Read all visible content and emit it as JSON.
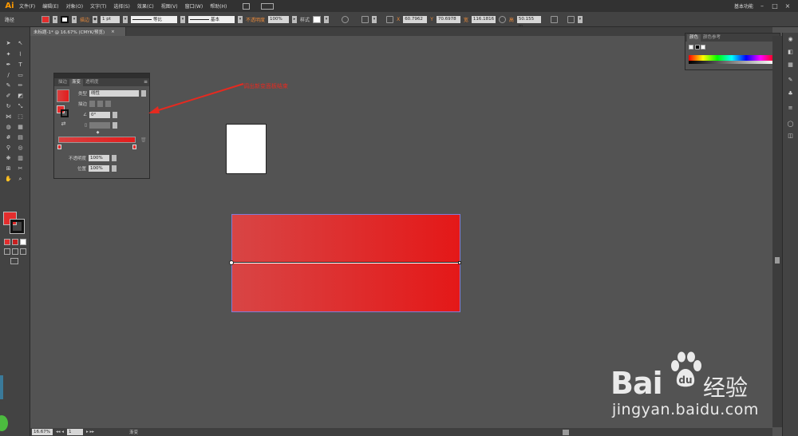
{
  "app": {
    "logo": "Ai",
    "menus": [
      "文件(F)",
      "编辑(E)",
      "对象(O)",
      "文字(T)",
      "选择(S)",
      "效果(C)",
      "视图(V)",
      "窗口(W)",
      "帮助(H)"
    ],
    "workspace": "基本功能",
    "window_controls": [
      "–",
      "□",
      "×"
    ]
  },
  "control_bar": {
    "object_type": "路径",
    "stroke_label": "描边",
    "stroke_weight": "1 pt",
    "stroke_profile": "等比",
    "brush": "基本",
    "opacity_label": "不透明度",
    "opacity_value": "100%",
    "style_label": "样式",
    "x_label": "X",
    "x_value": "60.7962",
    "y_label": "Y",
    "y_value": "70.6978",
    "w_label": "宽",
    "w_value": "116.1816",
    "h_label": "高",
    "h_value": "50.155 m"
  },
  "document": {
    "tab_title": "未标题-1* @ 16.67% (CMYK/预览)",
    "tab_close": "×"
  },
  "gradient_panel": {
    "tabs": [
      "描边",
      "渐变",
      "透明度"
    ],
    "active_tab": "渐变",
    "type_label": "类型",
    "type_value": "线性",
    "stroke_label": "描边",
    "angle_value": "0°",
    "opacity_label": "不透明度",
    "opacity_value": "100%",
    "location_label": "位置",
    "location_value": "100%"
  },
  "annotation": {
    "text": "调出新变面板结束"
  },
  "color_panel": {
    "tabs": [
      "颜色",
      "颜色参考"
    ],
    "active_tab": "颜色"
  },
  "status_bar": {
    "zoom": "16.67%",
    "artboard": "1",
    "tool": "渐变"
  },
  "colors": {
    "accent_fill": "#e42d2d",
    "gradient_start": "#d84545",
    "gradient_end": "#e41818",
    "annotation_red": "#e52a20",
    "selection_blue": "#7f7bd8"
  },
  "watermark": {
    "brand": "Bai",
    "brand_suffix": "经验",
    "url": "jingyan.baidu.com"
  }
}
